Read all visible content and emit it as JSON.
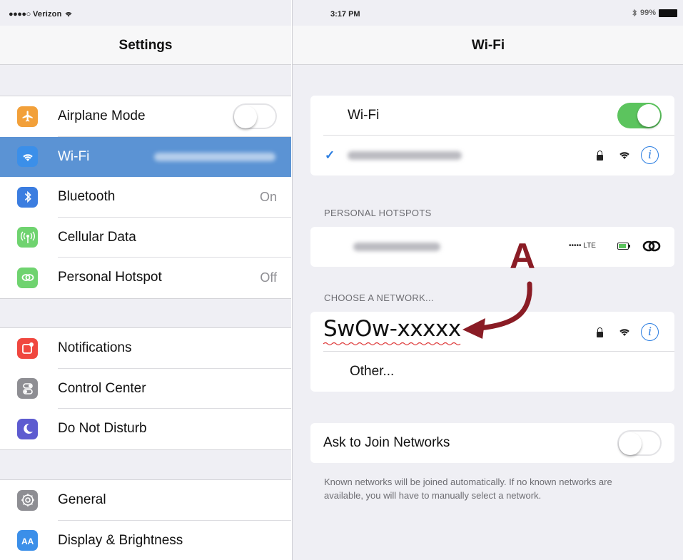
{
  "status_bar": {
    "carrier": "Verizon",
    "signal_dots": "●●●●○",
    "time": "3:17 PM",
    "battery": "99%"
  },
  "settings": {
    "title": "Settings",
    "groups": [
      [
        {
          "label": "Airplane Mode",
          "icon": "airplane-icon",
          "icon_color": "#f2a03a",
          "control": "toggle-off"
        },
        {
          "label": "Wi-Fi",
          "icon": "wifi-icon",
          "icon_color": "#3b8fe9",
          "selected": true
        },
        {
          "label": "Bluetooth",
          "icon": "bluetooth-icon",
          "icon_color": "#3b7de0",
          "value": "On"
        },
        {
          "label": "Cellular Data",
          "icon": "cellular-icon",
          "icon_color": "#6fd36f"
        },
        {
          "label": "Personal Hotspot",
          "icon": "hotspot-icon",
          "icon_color": "#6fd36f",
          "value": "Off"
        }
      ],
      [
        {
          "label": "Notifications",
          "icon": "notifications-icon",
          "icon_color": "#f0473f"
        },
        {
          "label": "Control Center",
          "icon": "control-center-icon",
          "icon_color": "#8e8e93"
        },
        {
          "label": "Do Not Disturb",
          "icon": "moon-icon",
          "icon_color": "#5d5bd0"
        }
      ],
      [
        {
          "label": "General",
          "icon": "gear-icon",
          "icon_color": "#8e8e93"
        },
        {
          "label": "Display & Brightness",
          "icon": "display-brightness-icon",
          "icon_color": "#3b8fe9"
        }
      ]
    ]
  },
  "wifi_detail": {
    "title": "Wi-Fi",
    "wifi_label": "Wi-Fi",
    "wifi_enabled": true,
    "personal_hotspots_header": "PERSONAL HOTSPOTS",
    "hotspot_status": "••••• LTE",
    "choose_network_header": "CHOOSE A NETWORK...",
    "network_name": "SwOw-xxxxx",
    "other_label": "Other...",
    "ask_to_join_label": "Ask to Join Networks",
    "ask_to_join_enabled": false,
    "footnote": "Known networks will be joined automatically. If no known networks are available, you will have to manually select a network."
  },
  "annotation": {
    "letter": "A",
    "color": "#8a1c25"
  }
}
